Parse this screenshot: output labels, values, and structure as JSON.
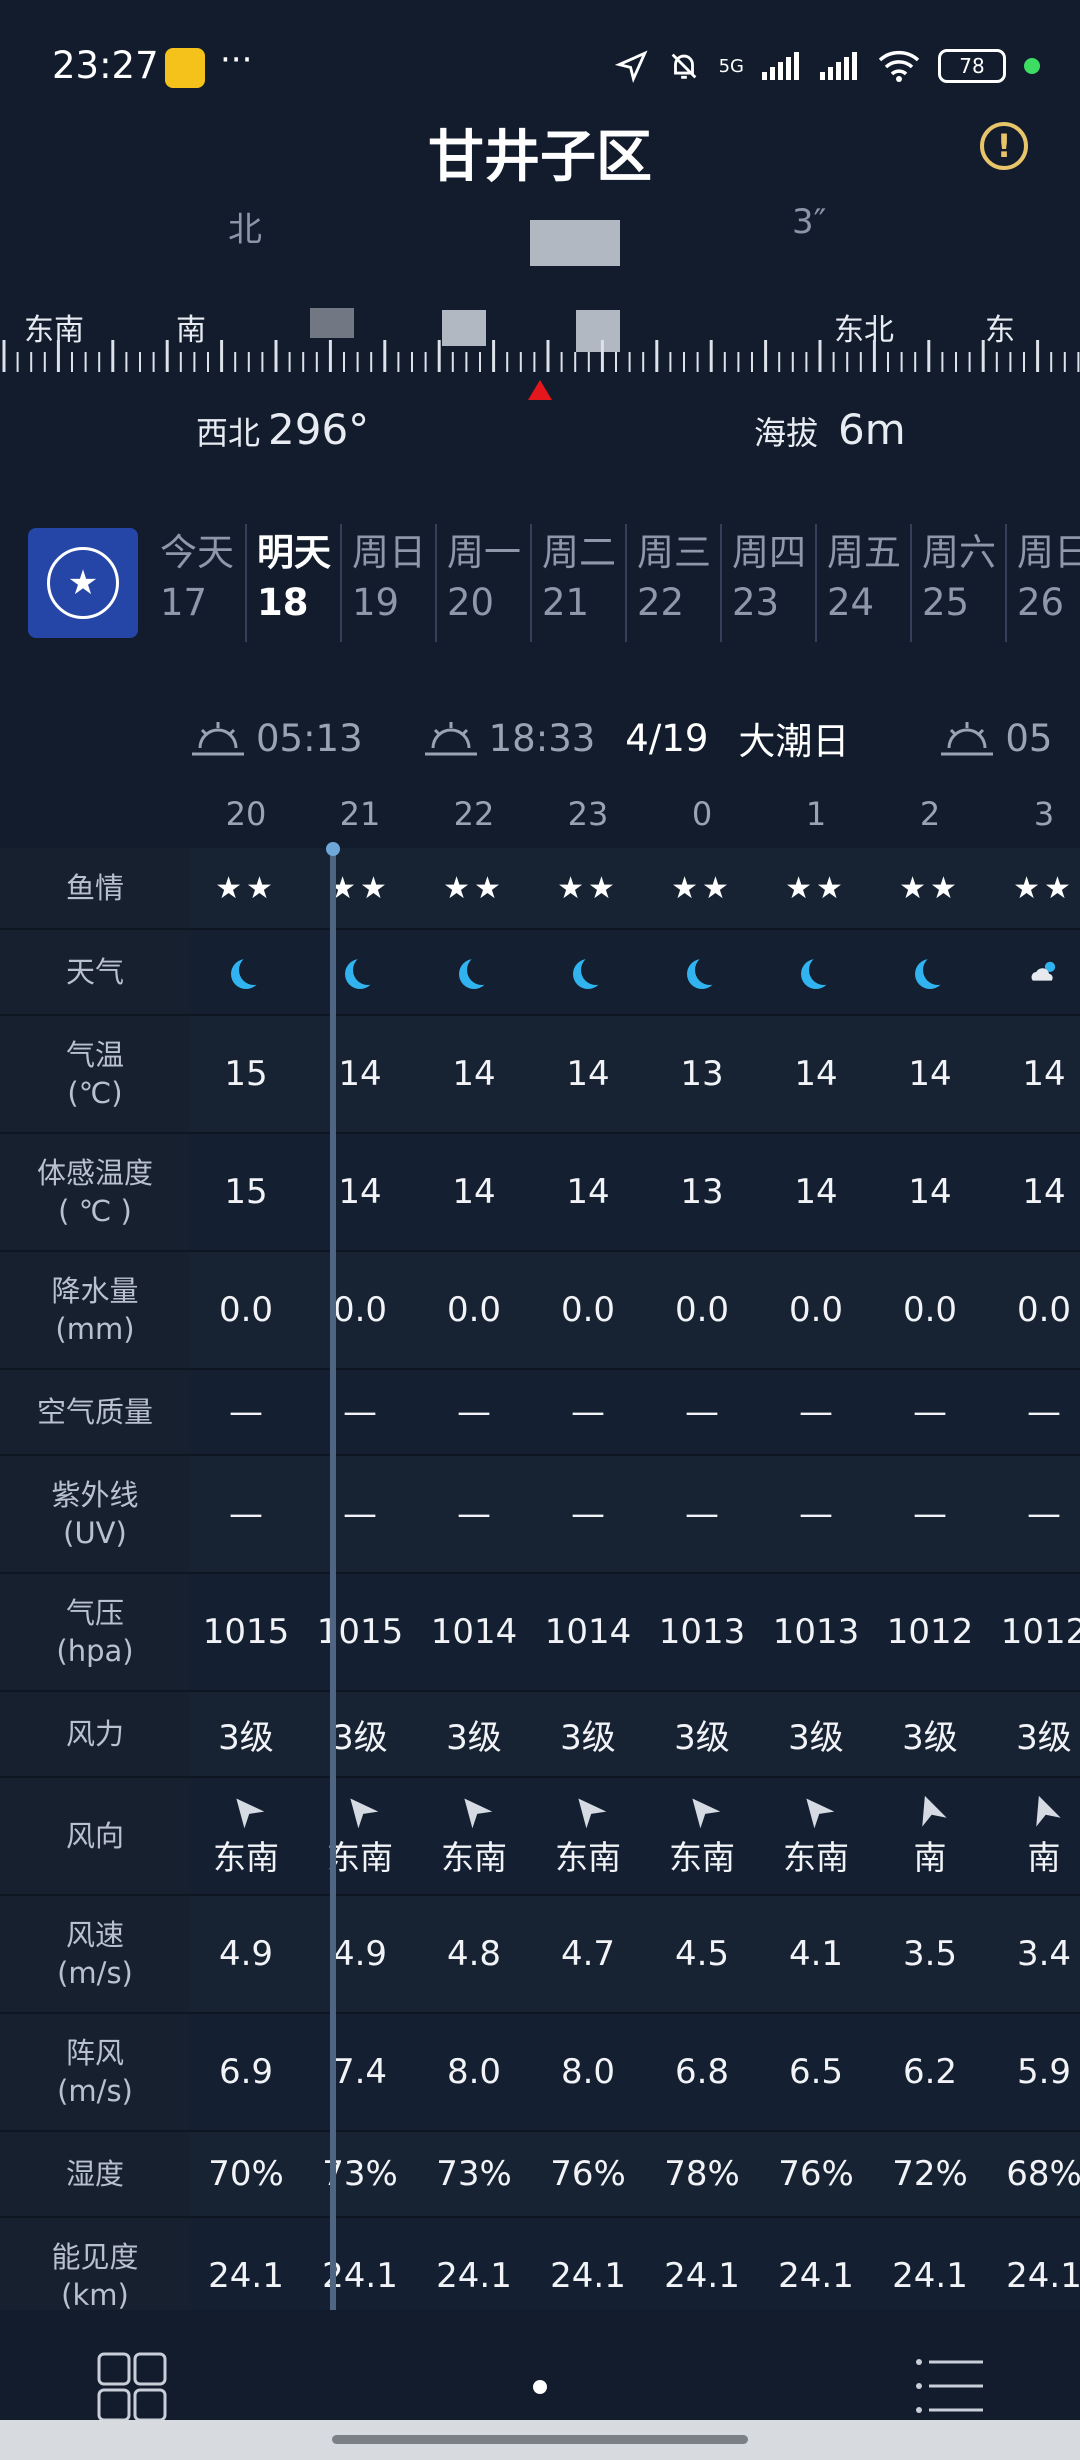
{
  "status_bar": {
    "time": "23:27",
    "more": "···",
    "battery": "78",
    "network": "5G"
  },
  "header": {
    "title": "甘井子区",
    "alert_icon": "exclamation-circle-icon"
  },
  "compass": {
    "upper_faded": {
      "left": "北",
      "right": "3″"
    },
    "directions": [
      "东南",
      "南",
      "东北",
      "东"
    ],
    "heading_dir": "西北",
    "heading_deg": "296°",
    "altitude_label": "海拔",
    "altitude_value": "6m"
  },
  "days": [
    {
      "name": "今天",
      "date": "17"
    },
    {
      "name": "明天",
      "date": "18",
      "active": true
    },
    {
      "name": "周日",
      "date": "19"
    },
    {
      "name": "周一",
      "date": "20"
    },
    {
      "name": "周二",
      "date": "21"
    },
    {
      "name": "周三",
      "date": "22"
    },
    {
      "name": "周四",
      "date": "23"
    },
    {
      "name": "周五",
      "date": "24"
    },
    {
      "name": "周六",
      "date": "25"
    },
    {
      "name": "周日",
      "date": "26"
    }
  ],
  "sun_row": {
    "sunrise": "05:13",
    "sunset": "18:33",
    "lunar_date": "4/19",
    "tide": "大潮日",
    "next_sunrise_partial": "05"
  },
  "hours": [
    "20",
    "21",
    "22",
    "23",
    "0",
    "1",
    "2",
    "3"
  ],
  "rows": [
    {
      "key": "fishing",
      "label": "鱼情",
      "values": [
        "★★",
        "★★",
        "★★",
        "★★",
        "★★",
        "★★",
        "★★",
        "★★"
      ]
    },
    {
      "key": "weather",
      "label": "天气",
      "icons": [
        "moon-icon",
        "moon-icon",
        "moon-icon",
        "moon-icon",
        "moon-icon",
        "moon-icon",
        "moon-icon",
        "cloudy-night-icon"
      ]
    },
    {
      "key": "temp",
      "label": "气温",
      "sub": "(℃)",
      "values": [
        "15",
        "14",
        "14",
        "14",
        "13",
        "14",
        "14",
        "14"
      ]
    },
    {
      "key": "feels",
      "label": "体感温度",
      "sub": "( ℃ )",
      "values": [
        "15",
        "14",
        "14",
        "14",
        "13",
        "14",
        "14",
        "14"
      ]
    },
    {
      "key": "precip",
      "label": "降水量",
      "sub": "(mm)",
      "values": [
        "0.0",
        "0.0",
        "0.0",
        "0.0",
        "0.0",
        "0.0",
        "0.0",
        "0.0"
      ]
    },
    {
      "key": "aqi",
      "label": "空气质量",
      "values": [
        "—",
        "—",
        "—",
        "—",
        "—",
        "—",
        "—",
        "—"
      ]
    },
    {
      "key": "uv",
      "label": "紫外线",
      "sub": "(UV)",
      "values": [
        "—",
        "—",
        "—",
        "—",
        "—",
        "—",
        "—",
        "—"
      ]
    },
    {
      "key": "pressure",
      "label": "气压",
      "sub": "(hpa)",
      "values": [
        "1015",
        "1015",
        "1014",
        "1014",
        "1013",
        "1013",
        "1012",
        "1012"
      ]
    },
    {
      "key": "wind_force",
      "label": "风力",
      "values": [
        "3级",
        "3级",
        "3级",
        "3级",
        "3级",
        "3级",
        "3级",
        "3级"
      ]
    },
    {
      "key": "wind_dir",
      "label": "风向",
      "values": [
        "东南",
        "东南",
        "东南",
        "东南",
        "东南",
        "东南",
        "南",
        "南"
      ],
      "rotations": [
        -40,
        -40,
        -40,
        -40,
        -40,
        -40,
        -20,
        -20
      ]
    },
    {
      "key": "wind_speed",
      "label": "风速",
      "sub": "(m/s)",
      "values": [
        "4.9",
        "4.9",
        "4.8",
        "4.7",
        "4.5",
        "4.1",
        "3.5",
        "3.4"
      ]
    },
    {
      "key": "gust",
      "label": "阵风",
      "sub": "(m/s)",
      "values": [
        "6.9",
        "7.4",
        "8.0",
        "8.0",
        "6.8",
        "6.5",
        "6.2",
        "5.9"
      ]
    },
    {
      "key": "humidity",
      "label": "湿度",
      "values": [
        "70%",
        "73%",
        "73%",
        "76%",
        "78%",
        "76%",
        "72%",
        "68%"
      ]
    },
    {
      "key": "visibility",
      "label": "能见度",
      "sub": "(km)",
      "values": [
        "24.1",
        "24.1",
        "24.1",
        "24.1",
        "24.1",
        "24.1",
        "24.1",
        "24.1"
      ]
    }
  ],
  "bottom_nav": {
    "left_icon": "grid-icon",
    "right_icon": "list-icon"
  }
}
